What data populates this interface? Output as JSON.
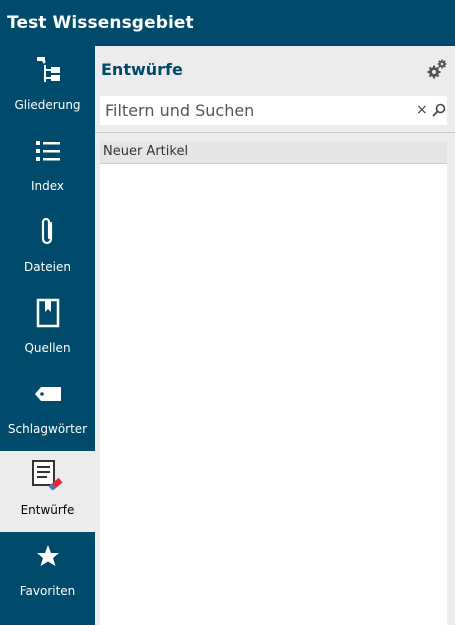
{
  "app": {
    "title": "Test Wissensgebiet"
  },
  "sidebar": {
    "items": [
      {
        "label": "Gliederung",
        "icon": "outline-tree-icon"
      },
      {
        "label": "Index",
        "icon": "list-icon"
      },
      {
        "label": "Dateien",
        "icon": "paperclip-icon"
      },
      {
        "label": "Quellen",
        "icon": "bookmark-icon"
      },
      {
        "label": "Schlagwörter",
        "icon": "tag-icon"
      },
      {
        "label": "Entwürfe",
        "icon": "draft-icon",
        "active": true
      },
      {
        "label": "Favoriten",
        "icon": "star-icon"
      }
    ]
  },
  "panel": {
    "title": "Entwürfe",
    "search": {
      "placeholder": "Filtern und Suchen",
      "clear": "×"
    },
    "items": [
      {
        "label": "Neuer Artikel"
      }
    ]
  },
  "colors": {
    "brand": "#004b6b",
    "panel": "#ececec",
    "active": "#ececec",
    "accent_red": "#e02b3a"
  }
}
